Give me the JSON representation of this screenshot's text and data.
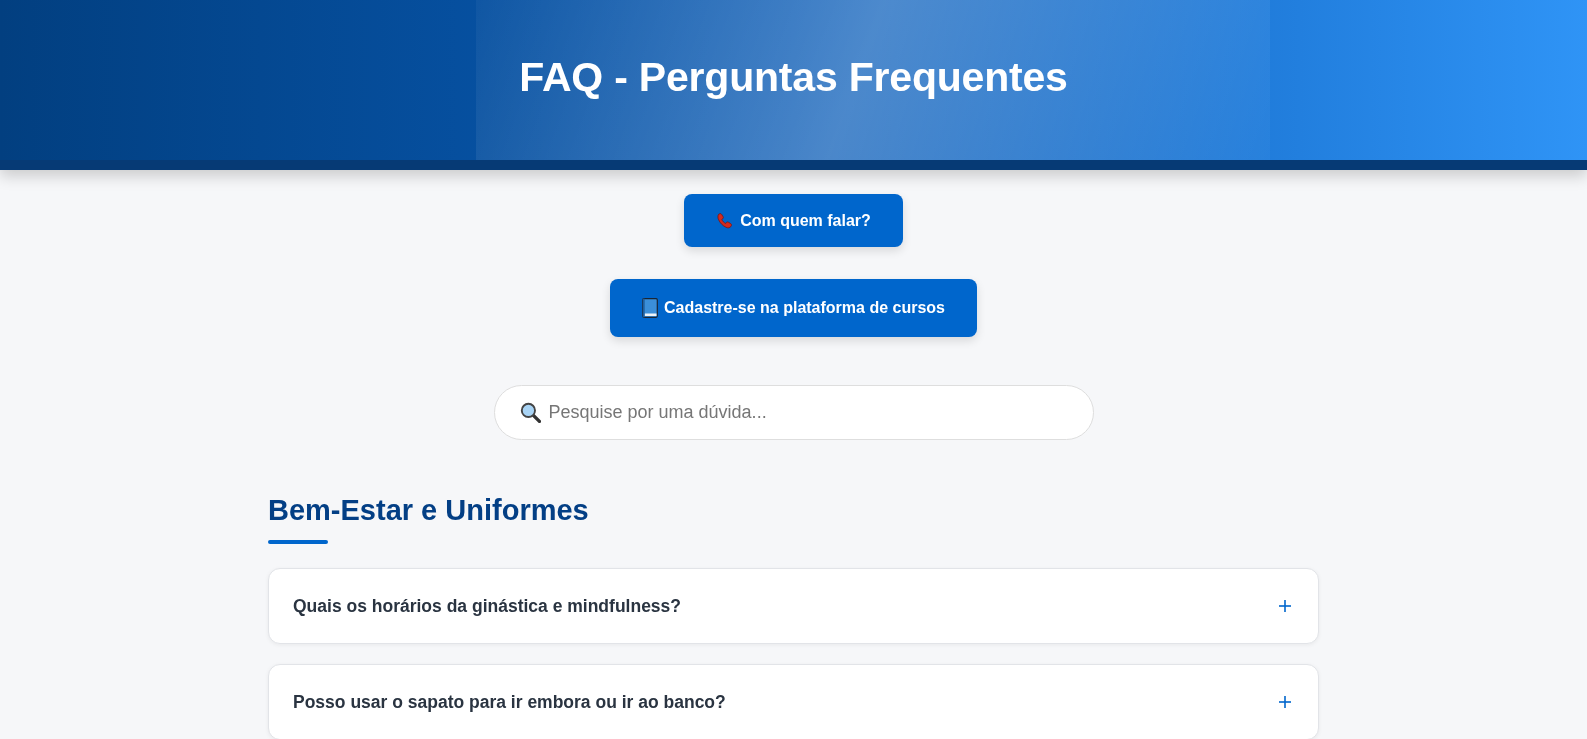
{
  "header": {
    "title": "FAQ - Perguntas Frequentes"
  },
  "actions": [
    {
      "kind": "phone",
      "label": "Com quem falar?"
    },
    {
      "kind": "book",
      "label": "Cadastre-se na plataforma de cursos"
    }
  ],
  "search": {
    "placeholder": "Pesquise por uma dúvida..."
  },
  "sections": [
    {
      "title": "Bem-Estar e Uniformes",
      "questions": [
        {
          "text": "Quais os horários da ginástica e mindfulness?",
          "expanded": false
        },
        {
          "text": "Posso usar o sapato para ir embora ou ir ao banco?",
          "expanded": false
        }
      ]
    }
  ]
}
